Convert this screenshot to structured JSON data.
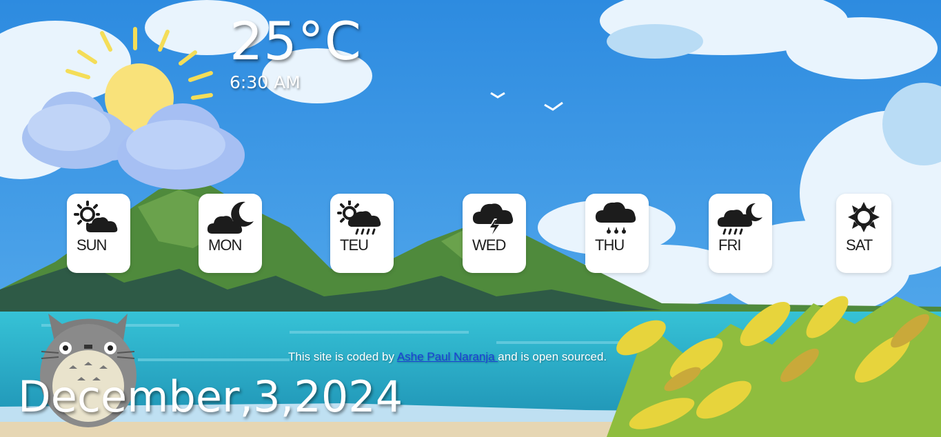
{
  "weather": {
    "temperature": "25°C",
    "time": "6:30 AM",
    "current_icon": "sun-behind-clouds-icon"
  },
  "forecast": [
    {
      "day": "SUN",
      "icon": "sun-cloud-icon"
    },
    {
      "day": "MON",
      "icon": "moon-cloud-icon"
    },
    {
      "day": "TEU",
      "icon": "sun-cloud-rain-icon"
    },
    {
      "day": "WED",
      "icon": "thunderstorm-icon"
    },
    {
      "day": "THU",
      "icon": "rain-cloud-icon"
    },
    {
      "day": "FRI",
      "icon": "moon-cloud-rain-icon"
    },
    {
      "day": "SAT",
      "icon": "sun-icon"
    }
  ],
  "footer": {
    "prefix": "This site is coded by ",
    "author_link": "Ashe Paul Naranja ",
    "suffix": "and is open sourced."
  },
  "date": "December,3,2024",
  "colors": {
    "sky": "#2f8fe0",
    "sea": "#2fb3cc",
    "hill": "#4f8a3c",
    "card": "#ffffff",
    "icon": "#1c1c1c",
    "link": "#1a3fd6"
  }
}
